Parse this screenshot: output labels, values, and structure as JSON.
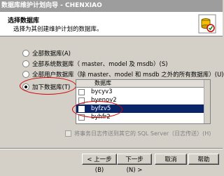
{
  "window": {
    "title": "数据库维护计划向导 - CHENXIAO"
  },
  "header": {
    "title": "选择数据库",
    "subtitle": "选择为其创建维护计划的数据库。",
    "icon": "wizard-database-icon"
  },
  "options": [
    {
      "label": "全部数据库(A)",
      "selected": false
    },
    {
      "label": "全部系统数据库（ master、model 及 msdb）(S)",
      "selected": false
    },
    {
      "label": "全部用户数据库（除 master、model 和 msdb 之外的所有数据库）(U)",
      "selected": false
    },
    {
      "label": "加下数据库(T)",
      "selected": true
    }
  ],
  "db_list": {
    "column_header": "数据库",
    "items": [
      {
        "name": "bycyv3",
        "checked": false,
        "selected": false
      },
      {
        "name": "byenov2",
        "checked": false,
        "selected": false
      },
      {
        "name": "byfzv5",
        "checked": true,
        "selected": true
      },
      {
        "name": "byhfr2",
        "checked": false,
        "selected": false
      }
    ]
  },
  "log_option": {
    "label": "将事务日志传送到其它的 SQL Server（日志传送）(H)",
    "enabled": false
  },
  "buttons": {
    "back": "< 上一步(B)",
    "next": "下一步(N) >",
    "cancel": "取消",
    "help": "帮助"
  },
  "colors": {
    "selection": "#0a246a",
    "annotation": "#d00000",
    "dialog": "#d4d0c8"
  }
}
